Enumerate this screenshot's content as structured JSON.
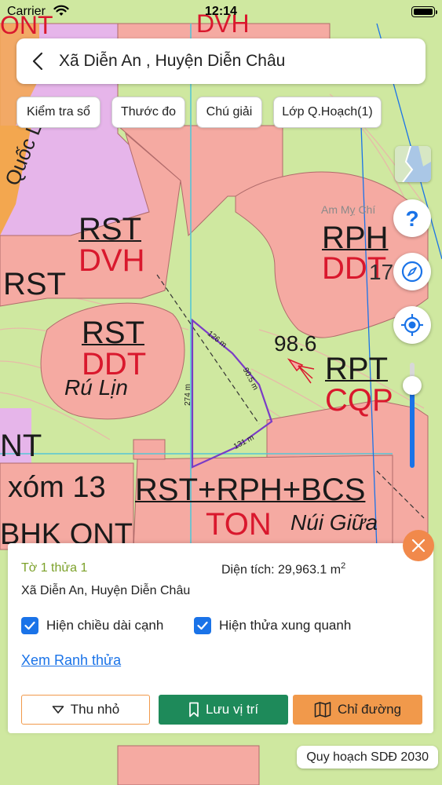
{
  "status_bar": {
    "carrier": "Carrier",
    "time": "12:14"
  },
  "header": {
    "title": "Xã Diễn An , Huyện Diễn Châu"
  },
  "toolbar": {
    "chips": [
      "Kiểm tra sổ",
      "Thước đo",
      "Chú giải",
      "Lớp Q.Hoạch(1)"
    ]
  },
  "map": {
    "labels": {
      "rst_dvh_top": "RST",
      "rst_dvh_bottom": "DVH",
      "rst_left": "RST",
      "rst_ddt_top": "RST",
      "rst_ddt_bottom": "DDT",
      "ru_lin": "Rú Lịn",
      "rph_top": "RPH",
      "rph_bottom": "DDT",
      "num_17": "17",
      "elevation": "98.6",
      "rpt_top": "RPT",
      "rpt_bottom": "CQP",
      "am_my_chi": "Am Mỵ Chí",
      "xom13": "xóm 13",
      "rst_rph_bcs": "RST+RPH+BCS",
      "ton": "TON",
      "nui_giua": "Núi Giữa",
      "bhk_ont": "BHK ONT",
      "nt": "NT",
      "dvh_top": "DVH",
      "ont_top": "ONT",
      "quoc_lo": "Quốc Lộ"
    },
    "edges": {
      "e1": "126 m",
      "e2": "90.5 m",
      "e3": "131 m",
      "e4": "274 m"
    },
    "colors": {
      "base": "#cfe8a0",
      "pink": "#f5aaa2",
      "violet": "#e3b3e8",
      "grid": "#56c6d6",
      "parcel": "#7a3cc6"
    }
  },
  "controls": {
    "help_icon": "question-icon",
    "compass_icon": "compass-icon",
    "locate_icon": "locate-icon",
    "opacity_level": 0.78
  },
  "panel": {
    "sheet_parcel": "Tờ 1 thửa 1",
    "area_label": "Diện tích: 29,963.1 m",
    "area_sup": "2",
    "address": "Xã Diễn An, Huyện Diễn Châu",
    "check_edge_length": "Hiện chiều dài cạnh",
    "check_neighbors": "Hiện thửa xung quanh",
    "link": "Xem Ranh thửa",
    "btn_collapse": "Thu nhỏ",
    "btn_save": "Lưu vị trí",
    "btn_direction": "Chỉ đường",
    "btn_colors": {
      "save": "#1e8a5a",
      "direction": "#f1994b"
    }
  },
  "footer": {
    "plan_label": "Quy hoạch SDĐ 2030"
  }
}
